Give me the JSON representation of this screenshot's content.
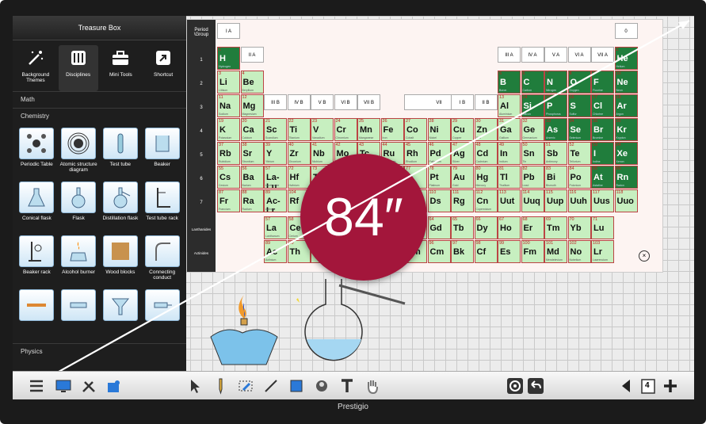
{
  "sidebar": {
    "title": "Treasure Box",
    "top_tools": [
      {
        "label": "Background Themes",
        "icon": "magic-wand-icon"
      },
      {
        "label": "Disciplines",
        "icon": "book-icon"
      },
      {
        "label": "Mini Tools",
        "icon": "toolbox-icon"
      },
      {
        "label": "Shortcut",
        "icon": "shortcut-icon"
      }
    ],
    "sections": {
      "math": "Math",
      "chemistry": "Chemistry",
      "physics": "Physics"
    },
    "chemistry_items": [
      {
        "label": "Periodic Table"
      },
      {
        "label": "Atomic structure diagram"
      },
      {
        "label": "Test tube"
      },
      {
        "label": "Beaker"
      },
      {
        "label": "Conical flask"
      },
      {
        "label": "Flask"
      },
      {
        "label": "Distillation flask"
      },
      {
        "label": "Test tube rack"
      },
      {
        "label": "Beaker rack"
      },
      {
        "label": "Alcohol burner"
      },
      {
        "label": "Wood blocks"
      },
      {
        "label": "Connecting conduct"
      },
      {
        "label": ""
      },
      {
        "label": ""
      },
      {
        "label": ""
      },
      {
        "label": ""
      }
    ]
  },
  "periodic_table": {
    "header_label": "Period \\Group",
    "periods": [
      "1",
      "2",
      "3",
      "4",
      "5",
      "6",
      "7"
    ],
    "lanthanides_label": "Lanthanides",
    "actinides_label": "Actinides",
    "groups": {
      "IA": "I A",
      "IIA": "II A",
      "IIIB": "III B",
      "IVB": "IV B",
      "VB": "V B",
      "VIB": "VI B",
      "VIIB": "VII B",
      "VII": "VII",
      "IB": "I B",
      "IIB": "II B",
      "IIIA": "III A",
      "IVA": "IV A",
      "VA": "V A",
      "VIA": "VI A",
      "VIIA": "VII A",
      "zero": "0"
    }
  },
  "badge": {
    "text": "84″"
  },
  "taskbar": {
    "page": "4"
  },
  "brand": "Prestigio",
  "colors": {
    "badge": "#a3163b",
    "nonmetal": "#207d3c",
    "metal": "#c7efc0"
  }
}
